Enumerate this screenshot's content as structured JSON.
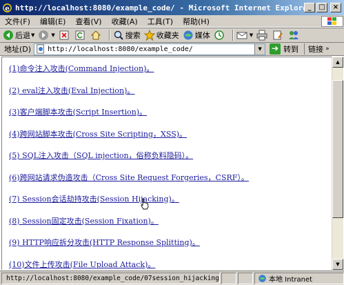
{
  "window": {
    "title": "http://localhost:8080/example_code/ - Microsoft Internet Explorer",
    "minimize": "_",
    "maximize": "□",
    "close": "×"
  },
  "menu": [
    "文件(F)",
    "编辑(E)",
    "查看(V)",
    "收藏(A)",
    "工具(T)",
    "帮助(H)"
  ],
  "toolbar": {
    "back_label": "后退",
    "search_label": "搜索",
    "favorites_label": "收藏夹",
    "media_label": "媒体"
  },
  "address": {
    "label": "地址(D)",
    "value": "http://localhost:8080/example_code/",
    "go_label": "转到",
    "links_label": "链接"
  },
  "links": [
    "(1)命令注入攻击(Command Injection)。",
    "(2) eval注入攻击(Eval Injection)。",
    "(3)客户端脚本攻击(Script Insertion)。",
    "(4)跨网站脚本攻击(Cross Site Scripting，XSS)。",
    "(5) SQL注入攻击（SQL injection，俗称负料隐码）。",
    "(6)跨网站请求伪造攻击（Cross Site Request Forgeries，CSRF）。",
    "(7) Session会话劫持攻击(Session Hijacking)。",
    "(8) Session固定攻击(Session Fixation)。",
    "(9) HTTP响应拆分攻击(HTTP Response Splitting)。",
    "(10)文件上传攻击(File Upload Attack)。"
  ],
  "status": {
    "text": "http://localhost:8080/example_code/07session_hijacking.h",
    "zone": "本地 Intranet"
  },
  "colors": {
    "link": "#1a1a9a",
    "chrome": "#d4d0c8",
    "title_start": "#0a246a"
  }
}
